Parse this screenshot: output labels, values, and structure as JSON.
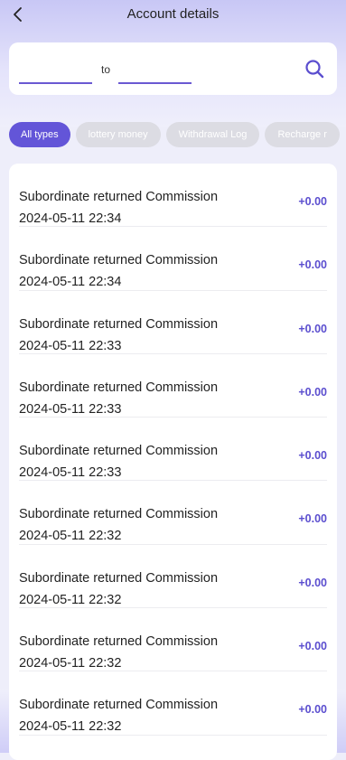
{
  "header": {
    "title": "Account details"
  },
  "filter": {
    "to_label": "to",
    "from_value": "",
    "to_value": ""
  },
  "tabs": [
    {
      "label": "All types",
      "active": true
    },
    {
      "label": "lottery money",
      "active": false
    },
    {
      "label": "Withdrawal Log",
      "active": false
    },
    {
      "label": "Recharge r",
      "active": false
    }
  ],
  "records": [
    {
      "title": "Subordinate returned Commission",
      "date": "2024-05-11 22:34",
      "amount": "+0.00"
    },
    {
      "title": "Subordinate returned Commission",
      "date": "2024-05-11 22:34",
      "amount": "+0.00"
    },
    {
      "title": "Subordinate returned Commission",
      "date": "2024-05-11 22:33",
      "amount": "+0.00"
    },
    {
      "title": "Subordinate returned Commission",
      "date": "2024-05-11 22:33",
      "amount": "+0.00"
    },
    {
      "title": "Subordinate returned Commission",
      "date": "2024-05-11 22:33",
      "amount": "+0.00"
    },
    {
      "title": "Subordinate returned Commission",
      "date": "2024-05-11 22:32",
      "amount": "+0.00"
    },
    {
      "title": "Subordinate returned Commission",
      "date": "2024-05-11 22:32",
      "amount": "+0.00"
    },
    {
      "title": "Subordinate returned Commission",
      "date": "2024-05-11 22:32",
      "amount": "+0.00"
    },
    {
      "title": "Subordinate returned Commission",
      "date": "2024-05-11 22:32",
      "amount": "+0.00"
    }
  ],
  "colors": {
    "accent": "#6355d8",
    "amount": "#5b4ecf",
    "tab_inactive": "#dcdce3"
  }
}
